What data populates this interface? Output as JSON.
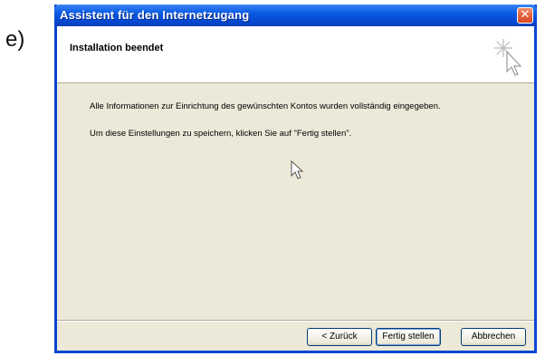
{
  "outer_label": "e)",
  "window": {
    "title": "Assistent für den Internetzugang",
    "close_glyph": "✕"
  },
  "header": {
    "title": "Installation beendet",
    "icon": "wizard-star-cursor-icon"
  },
  "body": {
    "paragraph1": "Alle Informationen zur Einrichtung des gewünschten Kontos wurden vollständig eingegeben.",
    "paragraph2": "Um diese Einstellungen zu speichern, klicken Sie auf \"Fertig stellen\"."
  },
  "buttons": {
    "back": "< Zurück",
    "finish": "Fertig stellen",
    "cancel": "Abbrechen"
  },
  "colors": {
    "titlebar": "#0a5ae3",
    "dialog_bg": "#ece9d8",
    "header_bg": "#ffffff",
    "close_btn": "#d8441c"
  }
}
